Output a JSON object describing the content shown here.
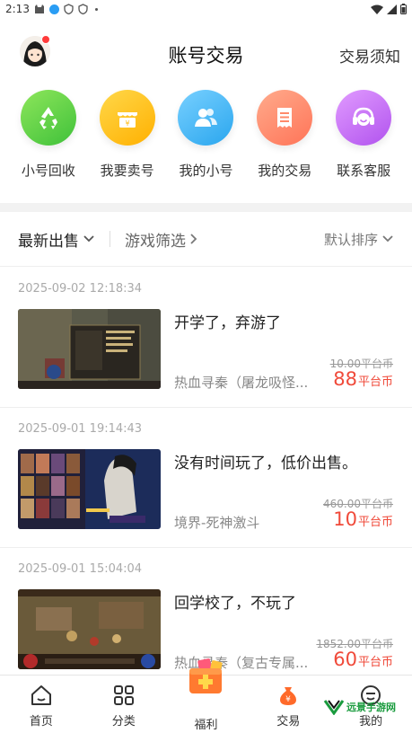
{
  "status_bar": {
    "time": "2:13"
  },
  "header": {
    "title": "账号交易",
    "notice": "交易须知"
  },
  "quick_menu": [
    {
      "label": "小号回收",
      "icon": "recycle-icon",
      "color": "#5bd04a"
    },
    {
      "label": "我要卖号",
      "icon": "shop-icon",
      "color": "#ffc21f"
    },
    {
      "label": "我的小号",
      "icon": "users-icon",
      "color": "#3fb6f2"
    },
    {
      "label": "我的交易",
      "icon": "receipt-icon",
      "color": "#ff8a6a"
    },
    {
      "label": "联系客服",
      "icon": "headset-icon",
      "color": "#c46df0"
    }
  ],
  "filters": {
    "latest": "最新出售",
    "game": "游戏筛选",
    "sort": "默认排序"
  },
  "listings": [
    {
      "time": "2025-09-02 12:18:34",
      "title": "开学了，弃游了",
      "game": "热血寻秦（屠龙吸怪...",
      "original_price": "10.00平台币",
      "price": "88",
      "unit": "平台币"
    },
    {
      "time": "2025-09-01 19:14:43",
      "title": "没有时间玩了，低价出售。",
      "game": "境界-死神激斗",
      "original_price": "460.00平台币",
      "price": "10",
      "unit": "平台币"
    },
    {
      "time": "2025-09-01 15:04:04",
      "title": "回学校了，不玩了",
      "game": "热血寻秦（复古专属...",
      "original_price": "1852.00平台币",
      "price": "60",
      "unit": "平台币"
    }
  ],
  "tabs": [
    {
      "label": "首页",
      "icon": "home-icon"
    },
    {
      "label": "分类",
      "icon": "grid-icon"
    },
    {
      "label": "福利",
      "icon": "gift-icon"
    },
    {
      "label": "交易",
      "icon": "money-bag-icon"
    },
    {
      "label": "我的",
      "icon": "profile-icon"
    }
  ],
  "colors": {
    "price": "#f04a3a",
    "accent_orange": "#ff7a30"
  },
  "watermark": "远景手游网"
}
